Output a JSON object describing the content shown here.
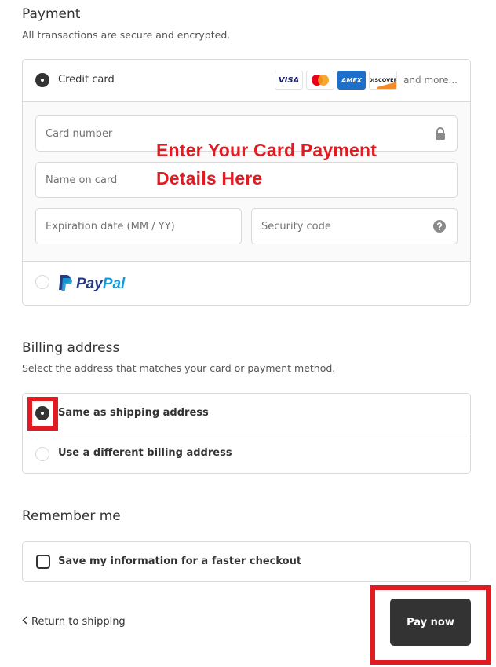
{
  "payment": {
    "title": "Payment",
    "subtitle": "All transactions are secure and encrypted.",
    "methods": {
      "credit_card": {
        "label": "Credit card",
        "selected": true,
        "logos": [
          "VISA",
          "mastercard",
          "AMEX",
          "DISCOVER"
        ],
        "and_more": "and more...",
        "fields": {
          "card_number": {
            "placeholder": "Card number",
            "value": "",
            "icon": "lock-icon"
          },
          "name_on_card": {
            "placeholder": "Name on card",
            "value": ""
          },
          "expiration": {
            "placeholder": "Expiration date (MM / YY)",
            "value": ""
          },
          "security_code": {
            "placeholder": "Security code",
            "value": "",
            "icon": "help-icon"
          }
        }
      },
      "paypal": {
        "label_pay": "Pay",
        "label_pal": "Pal",
        "selected": false
      }
    }
  },
  "annotation": {
    "line1": "Enter Your Card Payment",
    "line2": "Details Here",
    "color": "#e21b23"
  },
  "billing": {
    "title": "Billing address",
    "subtitle": "Select the address that matches your card or payment method.",
    "options": [
      {
        "label": "Same as shipping address",
        "selected": true
      },
      {
        "label": "Use a different billing address",
        "selected": false
      }
    ]
  },
  "remember": {
    "title": "Remember me",
    "checkbox_label": "Save my information for a faster checkout",
    "checked": false
  },
  "footer": {
    "return_label": "Return to shipping",
    "pay_label": "Pay now"
  },
  "colors": {
    "primary_button": "#333333",
    "highlight": "#e21b23"
  }
}
